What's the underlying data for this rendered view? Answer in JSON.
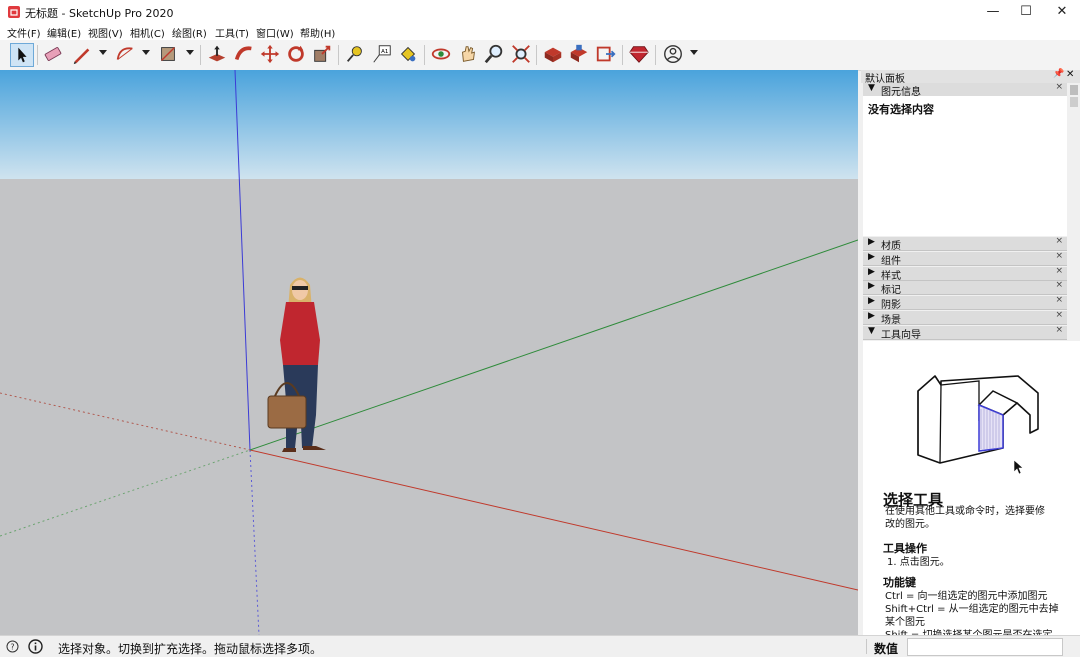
{
  "window": {
    "title": "无标题 - SketchUp Pro 2020",
    "minimize": "—",
    "maximize": "☐",
    "close": "✕"
  },
  "menu": [
    "文件(F)",
    "编辑(E)",
    "视图(V)",
    "相机(C)",
    "绘图(R)",
    "工具(T)",
    "窗口(W)",
    "帮助(H)"
  ],
  "toolbar": {
    "tools": [
      "select-tool-icon",
      "eraser-tool-icon",
      "pencil-line-tool-icon",
      "arc-tool-icon",
      "rectangle-tool-icon",
      "push-pull-icon",
      "follow-me-icon",
      "move-icon",
      "rotate-icon",
      "scale-icon",
      "tape-measure-icon",
      "text-tool-icon",
      "paint-bucket-icon",
      "orbit-icon",
      "pan-icon",
      "zoom-icon",
      "zoom-extents-icon",
      "warehouse-icon",
      "extension-warehouse-icon",
      "send-to-layout-icon",
      "ruby-console-icon",
      "account-icon"
    ],
    "text_tool_glyph": "A1"
  },
  "colors": {
    "sky_top": "#4aa3dc",
    "sky_bottom": "#cfe3ef",
    "ground": "#c3c4c6",
    "axis_blue": "#3b3bd6",
    "axis_red": "#c0392b",
    "axis_green": "#2e8b3a",
    "figure_sweater": "#c0262f",
    "figure_jeans": "#2a3a5a",
    "figure_bag": "#9b6b44"
  },
  "tray": {
    "title": "默认面板",
    "entity_info": {
      "header": "图元信息",
      "content": "没有选择内容"
    },
    "panels": [
      "材质",
      "组件",
      "样式",
      "标记",
      "阴影",
      "场景",
      "工具向导"
    ],
    "instructor": {
      "heading": "选择工具",
      "description": "在使用其他工具或命令时，选择要修改的图元。",
      "operation_heading": "工具操作",
      "operation_step": "1. 点击图元。",
      "keys_heading": "功能键",
      "keys": [
        "Ctrl = 向一组选定的图元中添加图元",
        "Shift+Ctrl = 从一组选定的图元中去掉",
        "某个图元",
        "Shift = 切换选择某个图元是否在选定"
      ]
    }
  },
  "status": {
    "text": "选择对象。切换到扩充选择。拖动鼠标选择多项。",
    "measurements_label": "数值",
    "measurements_value": ""
  }
}
